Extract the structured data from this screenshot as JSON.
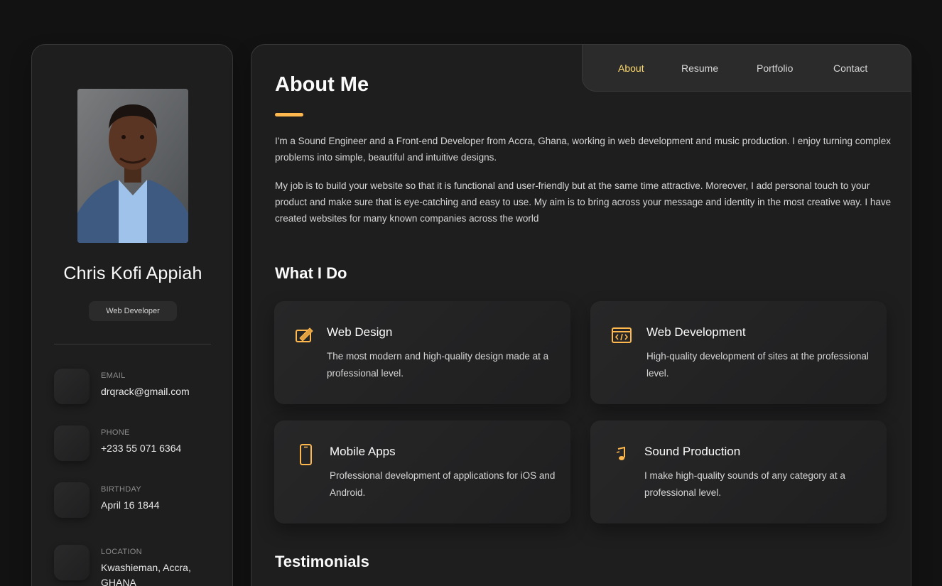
{
  "profile": {
    "name": "Chris Kofi Appiah",
    "title": "Web Developer"
  },
  "contacts": [
    {
      "label": "EMAIL",
      "value": "drqrack@gmail.com",
      "icon": "mail-icon"
    },
    {
      "label": "PHONE",
      "value": "+233 55 071 6364",
      "icon": "phone-icon"
    },
    {
      "label": "BIRTHDAY",
      "value": "April 16 1844",
      "icon": "calendar-icon"
    },
    {
      "label": "LOCATION",
      "value": "Kwashieman, Accra, GHANA",
      "icon": "location-icon"
    }
  ],
  "nav": {
    "items": [
      "About",
      "Resume",
      "Portfolio",
      "Contact"
    ],
    "active": "About"
  },
  "about": {
    "title": "About Me",
    "paragraphs": [
      "I'm a Sound Engineer and a Front-end Developer from Accra, Ghana, working in web development and music production. I enjoy turning complex problems into simple, beautiful and intuitive designs.",
      "My job is to build your website so that it is functional and user-friendly but at the same time attractive. Moreover, I add personal touch to your product and make sure that is eye-catching and easy to use. My aim is to bring across your message and identity in the most creative way. I have created websites for many known companies across the world"
    ]
  },
  "what_i_do": {
    "title": "What I Do",
    "services": [
      {
        "title": "Web Design",
        "text": "The most modern and high-quality design made at a professional level.",
        "icon": "design-icon"
      },
      {
        "title": "Web Development",
        "text": "High-quality development of sites at the professional level.",
        "icon": "code-icon"
      },
      {
        "title": "Mobile Apps",
        "text": "Professional development of applications for iOS and Android.",
        "icon": "mobile-icon"
      },
      {
        "title": "Sound Production",
        "text": "I make high-quality sounds of any category at a professional level.",
        "icon": "music-icon"
      }
    ]
  },
  "testimonials": {
    "title": "Testimonials"
  },
  "colors": {
    "accent": "#ffdb70",
    "accent_bar": "#ffb84d",
    "card_bg": "#1e1e1f",
    "page_bg": "#121212"
  }
}
